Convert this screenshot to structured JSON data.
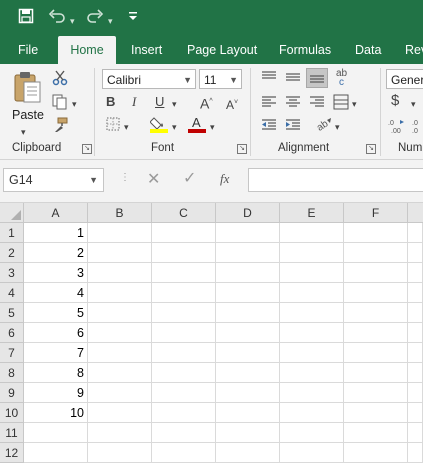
{
  "quick_access": {
    "save_icon": "save-icon",
    "undo_icon": "undo-icon",
    "redo_icon": "redo-icon",
    "customize_icon": "customize-qat-icon"
  },
  "tabs": [
    "File",
    "Home",
    "Insert",
    "Page Layout",
    "Formulas",
    "Data",
    "Rev"
  ],
  "active_tab": "Home",
  "ribbon": {
    "clipboard": {
      "paste_label": "Paste",
      "group_label": "Clipboard"
    },
    "font": {
      "font_name": "Calibri",
      "font_size": "11",
      "bold": "B",
      "italic": "I",
      "underline": "U",
      "group_label": "Font"
    },
    "alignment": {
      "group_label": "Alignment"
    },
    "number": {
      "format": "Genera",
      "group_label": "Num",
      "currency": "$"
    }
  },
  "formula_bar": {
    "name_box": "G14",
    "fx": "fx",
    "formula": ""
  },
  "columns": [
    "A",
    "B",
    "C",
    "D",
    "E",
    "F"
  ],
  "rows": [
    "1",
    "2",
    "3",
    "4",
    "5",
    "6",
    "7",
    "8",
    "9",
    "10",
    "11",
    "12"
  ],
  "cells_A": [
    "1",
    "2",
    "3",
    "4",
    "5",
    "6",
    "7",
    "8",
    "9",
    "10",
    "",
    ""
  ],
  "colors": {
    "brand": "#217346",
    "font_color": "#c00000",
    "highlight": "#ffff00"
  }
}
